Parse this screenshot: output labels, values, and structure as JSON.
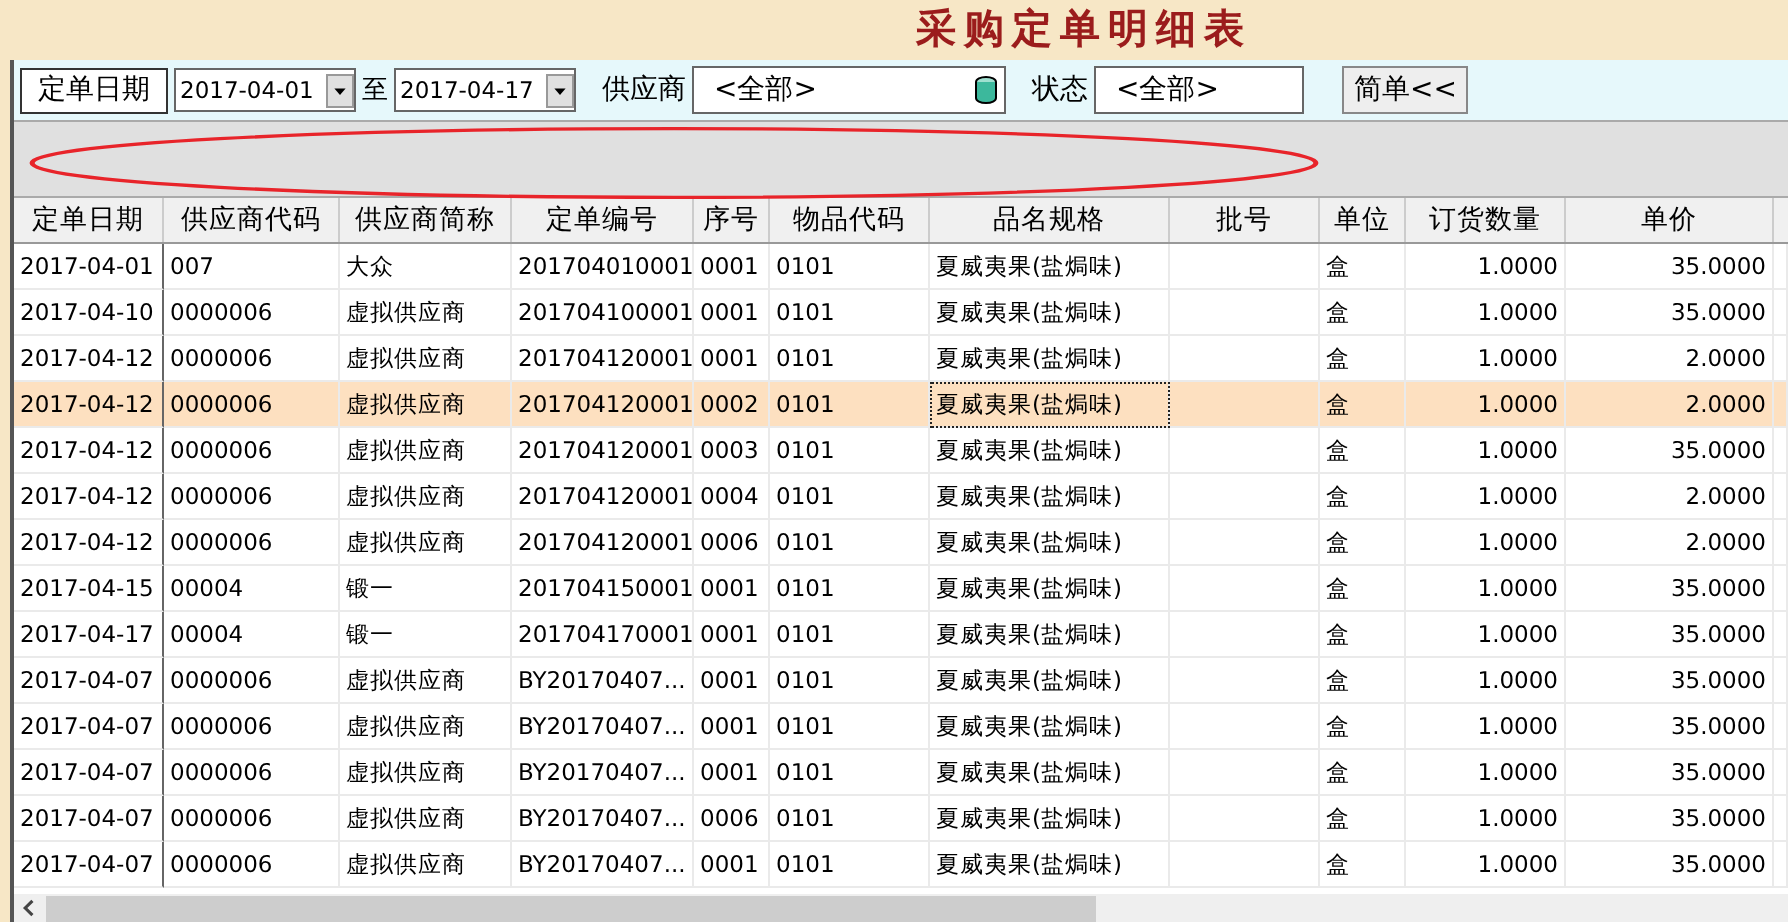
{
  "title": "采购定单明细表",
  "toolbar": {
    "date_label": "定单日期",
    "date_from": "2017-04-01",
    "to_label": "至",
    "date_to": "2017-04-17",
    "supplier_label": "供应商",
    "supplier_value": "<全部>",
    "status_label": "状态",
    "status_value": "<全部>",
    "simple_button": "简单<<"
  },
  "table": {
    "columns": [
      "定单日期",
      "供应商代码",
      "供应商简称",
      "定单编号",
      "序号",
      "物品代码",
      "品名规格",
      "批号",
      "单位",
      "订货数量",
      "单价"
    ],
    "rows": [
      {
        "selected": false,
        "cells": [
          "2017-04-01",
          "007",
          "大众",
          "201704010001",
          "0001",
          "0101",
          "夏威夷果(盐焗味)",
          "",
          "盒",
          "1.0000",
          "35.0000"
        ]
      },
      {
        "selected": false,
        "cells": [
          "2017-04-10",
          "0000006",
          "虚拟供应商",
          "201704100001",
          "0001",
          "0101",
          "夏威夷果(盐焗味)",
          "",
          "盒",
          "1.0000",
          "35.0000"
        ]
      },
      {
        "selected": false,
        "cells": [
          "2017-04-12",
          "0000006",
          "虚拟供应商",
          "201704120001",
          "0001",
          "0101",
          "夏威夷果(盐焗味)",
          "",
          "盒",
          "1.0000",
          "2.0000"
        ]
      },
      {
        "selected": true,
        "cells": [
          "2017-04-12",
          "0000006",
          "虚拟供应商",
          "201704120001",
          "0002",
          "0101",
          "夏威夷果(盐焗味)",
          "",
          "盒",
          "1.0000",
          "2.0000"
        ]
      },
      {
        "selected": false,
        "cells": [
          "2017-04-12",
          "0000006",
          "虚拟供应商",
          "201704120001",
          "0003",
          "0101",
          "夏威夷果(盐焗味)",
          "",
          "盒",
          "1.0000",
          "35.0000"
        ]
      },
      {
        "selected": false,
        "cells": [
          "2017-04-12",
          "0000006",
          "虚拟供应商",
          "201704120001",
          "0004",
          "0101",
          "夏威夷果(盐焗味)",
          "",
          "盒",
          "1.0000",
          "2.0000"
        ]
      },
      {
        "selected": false,
        "cells": [
          "2017-04-12",
          "0000006",
          "虚拟供应商",
          "201704120001",
          "0006",
          "0101",
          "夏威夷果(盐焗味)",
          "",
          "盒",
          "1.0000",
          "2.0000"
        ]
      },
      {
        "selected": false,
        "cells": [
          "2017-04-15",
          "00004",
          "锻一",
          "201704150001",
          "0001",
          "0101",
          "夏威夷果(盐焗味)",
          "",
          "盒",
          "1.0000",
          "35.0000"
        ]
      },
      {
        "selected": false,
        "cells": [
          "2017-04-17",
          "00004",
          "锻一",
          "201704170001",
          "0001",
          "0101",
          "夏威夷果(盐焗味)",
          "",
          "盒",
          "1.0000",
          "35.0000"
        ]
      },
      {
        "selected": false,
        "cells": [
          "2017-04-07",
          "0000006",
          "虚拟供应商",
          "BY20170407...",
          "0001",
          "0101",
          "夏威夷果(盐焗味)",
          "",
          "盒",
          "1.0000",
          "35.0000"
        ]
      },
      {
        "selected": false,
        "cells": [
          "2017-04-07",
          "0000006",
          "虚拟供应商",
          "BY20170407...",
          "0001",
          "0101",
          "夏威夷果(盐焗味)",
          "",
          "盒",
          "1.0000",
          "35.0000"
        ]
      },
      {
        "selected": false,
        "cells": [
          "2017-04-07",
          "0000006",
          "虚拟供应商",
          "BY20170407...",
          "0001",
          "0101",
          "夏威夷果(盐焗味)",
          "",
          "盒",
          "1.0000",
          "35.0000"
        ]
      },
      {
        "selected": false,
        "cells": [
          "2017-04-07",
          "0000006",
          "虚拟供应商",
          "BY20170407...",
          "0006",
          "0101",
          "夏威夷果(盐焗味)",
          "",
          "盒",
          "1.0000",
          "35.0000"
        ]
      },
      {
        "selected": false,
        "cells": [
          "2017-04-07",
          "0000006",
          "虚拟供应商",
          "BY20170407...",
          "0001",
          "0101",
          "夏威夷果(盐焗味)",
          "",
          "盒",
          "1.0000",
          "35.0000"
        ]
      }
    ]
  }
}
